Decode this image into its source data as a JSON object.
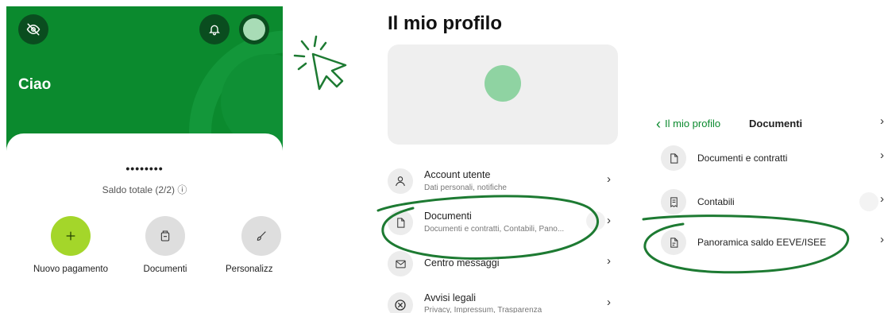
{
  "home": {
    "greeting": "Ciao",
    "balance_masked": "••••••••",
    "balance_label": "Saldo totale (2/2) ⓘ",
    "actions": [
      {
        "label": "Nuovo pagamento"
      },
      {
        "label": "Documenti"
      },
      {
        "label": "Personalizz"
      }
    ]
  },
  "profile": {
    "title": "Il mio profilo",
    "items": [
      {
        "title": "Account utente",
        "subtitle": "Dati personali, notifiche"
      },
      {
        "title": "Documenti",
        "subtitle": "Documenti e contratti, Contabili, Pano..."
      },
      {
        "title": "Centro messaggi",
        "subtitle": ""
      },
      {
        "title": "Avvisi legali",
        "subtitle": "Privacy, Impressum, Trasparenza"
      }
    ]
  },
  "documents": {
    "back_label": "Il mio profilo",
    "title": "Documenti",
    "items": [
      {
        "title": "Documenti e contratti"
      },
      {
        "title": "Contabili"
      },
      {
        "title": "Panoramica saldo EEVE/ISEE"
      }
    ]
  },
  "colors": {
    "brand_green": "#0b8a2e",
    "dark_green": "#0a4d1f",
    "lime": "#a4d62a",
    "annotation": "#1d7a32"
  }
}
